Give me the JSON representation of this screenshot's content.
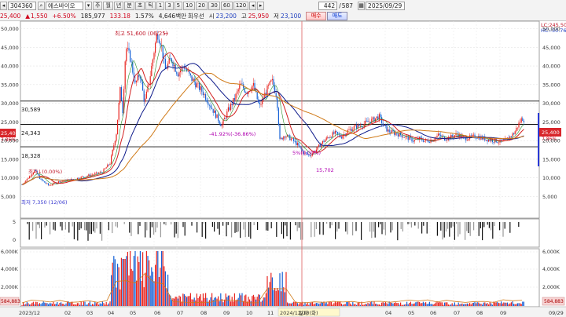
{
  "toolbar": {
    "back_icon": "◂",
    "price_left": "25,400",
    "code": "304360",
    "change": "1,550",
    "change_pct": "+6.50%",
    "volume": "185,977",
    "volume_ratio": "133.18",
    "turnover_pct": "1.57%",
    "amount": "4,646백만",
    "stock_type": "희우선",
    "name": "에스바이오",
    "periods": [
      "주",
      "월",
      "년",
      "분",
      "초",
      "틱"
    ],
    "minutes": [
      "1",
      "3",
      "5",
      "10",
      "20",
      "30",
      "60",
      "120"
    ],
    "counter": "442",
    "counter_total": "587",
    "date": "2025/09/29",
    "open_label": "시",
    "open": "23,200",
    "high_label": "고",
    "high": "25,950",
    "low_label": "저",
    "low": "23,100",
    "buy_label": "매수",
    "sell_label": "매도"
  },
  "chart": {
    "annotations": {
      "peak": "최고 51,600 (06/25)",
      "trough_left": "최저 7,350 (12/06)",
      "drop_left": "최저↓(0.00%)",
      "pct_mid": "-41.92%(-36.86%)",
      "mid_label": "5%(0.00%)",
      "low_mid": "15,702",
      "lc": "LC:245.50",
      "hc": "HC:-50.76"
    },
    "levels": [
      {
        "label": "30,589",
        "value": 30589
      },
      {
        "label": "24,343",
        "value": 24343
      },
      {
        "label": "18,328",
        "value": 18328
      }
    ],
    "current_price": "25,400",
    "current_pct": "7.86%",
    "y_ticks": [
      "50,000",
      "45,000",
      "40,000",
      "35,000",
      "30,000",
      "25,000",
      "20,000",
      "15,000",
      "10,000",
      "5,000"
    ],
    "indicator_ticks": [
      "5",
      "0"
    ],
    "volume_ticks": [
      "6,000K",
      "4,000K",
      "2,000K"
    ],
    "volume_current": "584,883",
    "x_ticks": [
      "2023/12",
      "02",
      "03",
      "04",
      "05",
      "06",
      "07",
      "08",
      "09",
      "10",
      "11",
      "12",
      "2024/12/10(화)",
      "04",
      "05",
      "06",
      "07",
      "08",
      "09",
      "09/29"
    ],
    "cursor_label": "일자",
    "colors": {
      "up": "#e8241f",
      "down": "#1560d6",
      "ma1": "#d21f1f",
      "ma2": "#0d1a8a",
      "ma3": "#d07a18",
      "ma4": "#2a8f2a",
      "cursor": "#e06060"
    }
  }
}
